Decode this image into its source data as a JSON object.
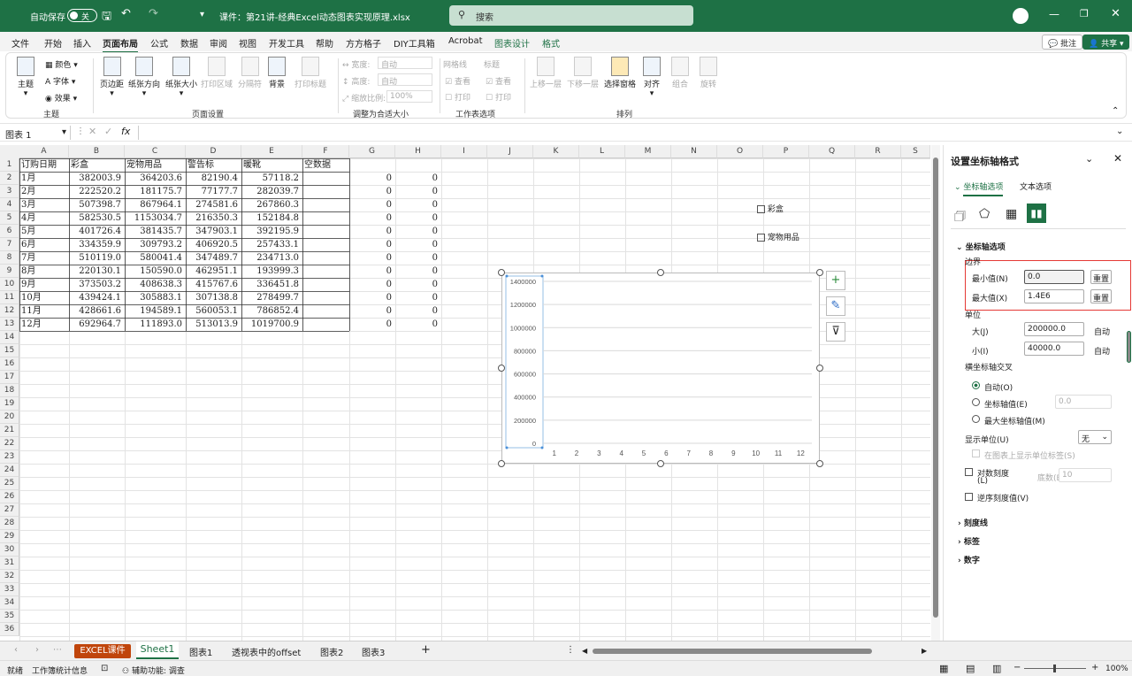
{
  "titlebar": {
    "autosave_label": "自动保存",
    "autosave_state": "关",
    "filename": "课件：第21讲-经典Excel动态图表实现原理.xlsx",
    "search_placeholder": "搜索"
  },
  "menu": [
    "文件",
    "开始",
    "插入",
    "页面布局",
    "公式",
    "数据",
    "审阅",
    "视图",
    "开发工具",
    "帮助",
    "方方格子",
    "DIY工具箱",
    "Acrobat",
    "图表设计",
    "格式"
  ],
  "menu_active": "页面布局",
  "top_buttons": {
    "comment": "批注",
    "share": "共享"
  },
  "ribbon": {
    "theme_group": {
      "theme": "主题",
      "colors": "颜色",
      "fonts": "字体",
      "effects": "效果",
      "label": "主题"
    },
    "page_setup": {
      "margins": "页边距",
      "orientation": "纸张方向",
      "size": "纸张大小",
      "print_area": "打印区域",
      "breaks": "分隔符",
      "background": "背景",
      "print_titles": "打印标题",
      "label": "页面设置"
    },
    "scale": {
      "width": "宽度:",
      "width_val": "自动",
      "height": "高度:",
      "height_val": "自动",
      "scale": "缩放比例:",
      "scale_val": "100%",
      "label": "调整为合适大小"
    },
    "sheet_options": {
      "gridlines": "网格线",
      "headings": "标题",
      "view": "查看",
      "print": "打印",
      "label": "工作表选项"
    },
    "arrange": {
      "forward": "上移一层",
      "backward": "下移一层",
      "selection": "选择窗格",
      "align": "对齐",
      "group": "组合",
      "rotate": "旋转",
      "label": "排列"
    }
  },
  "formula_bar": {
    "name_box": "图表 1",
    "fx": "fx",
    "content": ""
  },
  "columns": [
    "A",
    "B",
    "C",
    "D",
    "E",
    "F",
    "G",
    "H",
    "I",
    "J",
    "K",
    "L",
    "M",
    "N",
    "O",
    "P",
    "Q",
    "R",
    "S"
  ],
  "row_numbers": [
    "1",
    "2",
    "3",
    "4",
    "5",
    "6",
    "7",
    "8",
    "9",
    "10",
    "11",
    "12",
    "13",
    "14",
    "15",
    "16",
    "17",
    "18",
    "19",
    "20",
    "21",
    "22",
    "23",
    "24",
    "25",
    "26",
    "27",
    "28",
    "29",
    "30",
    "31",
    "32",
    "33",
    "34",
    "35",
    "36"
  ],
  "table": {
    "headers": [
      "订购日期",
      "彩盒",
      "宠物用品",
      "警告标",
      "暖靴",
      "空数据"
    ],
    "rows": [
      [
        "1月",
        "382003.9",
        "364203.6",
        "82190.4",
        "57118.2"
      ],
      [
        "2月",
        "222520.2",
        "181175.7",
        "77177.7",
        "282039.7"
      ],
      [
        "3月",
        "507398.7",
        "867964.1",
        "274581.6",
        "267860.3"
      ],
      [
        "4月",
        "582530.5",
        "1153034.7",
        "216350.3",
        "152184.8"
      ],
      [
        "5月",
        "401726.4",
        "381435.7",
        "347903.1",
        "392195.9"
      ],
      [
        "6月",
        "334359.9",
        "309793.2",
        "406920.5",
        "257433.1"
      ],
      [
        "7月",
        "510119.0",
        "580041.4",
        "347489.7",
        "234713.0"
      ],
      [
        "8月",
        "220130.1",
        "150590.0",
        "462951.1",
        "193999.3"
      ],
      [
        "9月",
        "373503.2",
        "408638.3",
        "415767.6",
        "336451.8"
      ],
      [
        "10月",
        "439424.1",
        "305883.1",
        "307138.8",
        "278499.7"
      ],
      [
        "11月",
        "428661.6",
        "194589.1",
        "560053.1",
        "786852.4"
      ],
      [
        "12月",
        "692964.7",
        "111893.0",
        "513013.9",
        "1019700.9"
      ]
    ]
  },
  "gh_values": [
    "0",
    "0",
    "0",
    "0",
    "0",
    "0",
    "0",
    "0",
    "0",
    "0",
    "0",
    "0"
  ],
  "checkbox_caidan": "彩盒",
  "checkbox_pet": "宠物用品",
  "chart_data": {
    "type": "line",
    "x": [
      "1",
      "2",
      "3",
      "4",
      "5",
      "6",
      "7",
      "8",
      "9",
      "10",
      "11",
      "12"
    ],
    "y_ticks": [
      "1400000",
      "1200000",
      "1000000",
      "800000",
      "600000",
      "400000",
      "200000",
      "0"
    ],
    "ylim": [
      0,
      1400000
    ],
    "major_unit": 200000,
    "series": [],
    "grid": true
  },
  "pane": {
    "title": "设置坐标轴格式",
    "tab_axis": "坐标轴选项",
    "tab_text": "文本选项",
    "section": "坐标轴选项",
    "bounds": "边界",
    "min_label": "最小值(N)",
    "min_val": "0.0",
    "max_label": "最大值(X)",
    "max_val": "1.4E6",
    "reset": "重置",
    "units": "单位",
    "major_label": "大(J)",
    "major_val": "200000.0",
    "minor_label": "小(I)",
    "minor_val": "40000.0",
    "auto": "自动",
    "cross": "横坐标轴交叉",
    "cross_auto": "自动(O)",
    "cross_val_label": "坐标轴值(E)",
    "cross_val": "0.0",
    "cross_max": "最大坐标轴值(M)",
    "display_units": "显示单位(U)",
    "display_units_val": "无",
    "show_units": "在图表上显示单位标签(S)",
    "log": "对数刻度",
    "log_l": "(L)",
    "base_label": "底数(B)",
    "base_val": "10",
    "reverse": "逆序刻度值(V)",
    "ticks": "刻度线",
    "labels": "标签",
    "number": "数字"
  },
  "sheet_tabs": [
    "EXCEL课件",
    "Sheet1",
    "图表1",
    "透视表中的offset",
    "图表2",
    "图表3"
  ],
  "status": {
    "ready": "就绪",
    "stats": "工作簿统计信息",
    "accessibility": "辅助功能: 调查",
    "zoom": "100%"
  },
  "colors": {
    "brand": "#1e7145",
    "selection_red": "#e53935",
    "tab_excel": "#c0450b"
  }
}
